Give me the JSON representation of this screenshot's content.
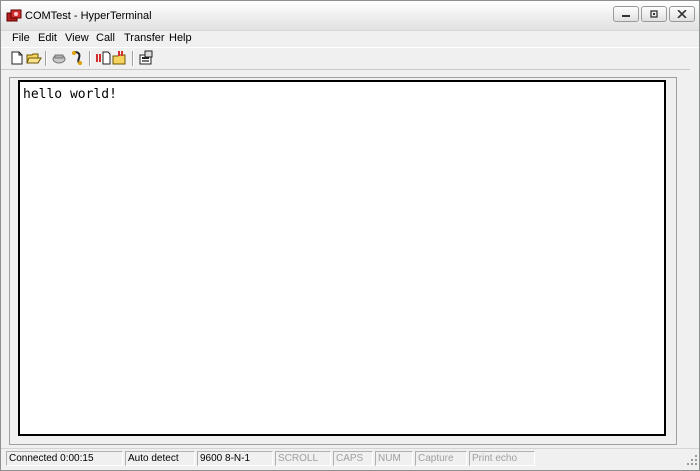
{
  "window": {
    "title": "COMTest - HyperTerminal"
  },
  "menu": {
    "items": [
      "File",
      "Edit",
      "View",
      "Call",
      "Transfer",
      "Help"
    ]
  },
  "toolbar": {
    "icons": [
      "new-file-icon",
      "open-folder-icon",
      "call-icon",
      "disconnect-icon",
      "send-file-icon",
      "receive-file-icon",
      "properties-icon"
    ]
  },
  "terminal": {
    "content": "hello world!"
  },
  "status": {
    "connected": "Connected 0:00:15",
    "detect": "Auto detect",
    "settings": "9600 8-N-1",
    "scroll": "SCROLL",
    "caps": "CAPS",
    "num": "NUM",
    "capture": "Capture",
    "print_echo": "Print echo"
  },
  "colors": {
    "terminal_background": "#ffffff",
    "terminal_text": "#000000",
    "disabled_text": "#a0a0a0"
  }
}
